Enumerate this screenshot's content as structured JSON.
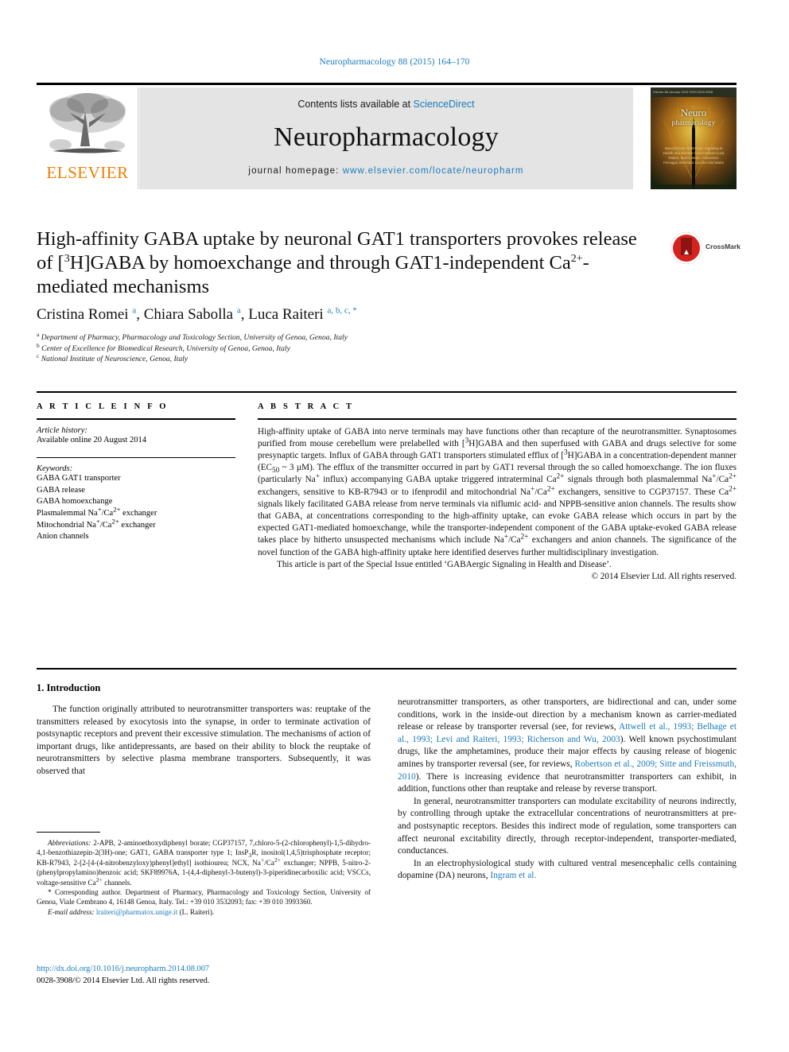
{
  "running_head": "Neuropharmacology 88 (2015) 164–170",
  "masthead": {
    "contents_prefix": "Contents lists available at ",
    "sciencedirect": "ScienceDirect",
    "journal_name": "Neuropharmacology",
    "homepage_prefix": "journal homepage: ",
    "homepage_url": "www.elsevier.com/locate/neuropharm",
    "publisher_logo_text": "ELSEVIER",
    "cover": {
      "title_main": "Neuro",
      "title_sub": "pharmacology",
      "topbar_left": "Volume 88  January 2015  ISSN 0028-3908",
      "topbar_right": "www.elsevier.com",
      "blurb": "Special Issue\nGABAergic Signaling in Health and Disease\n\nGuest Editors\nLuca Raiteri, Marco Beato,\nFrancesco Ferraguti, Bernhard Luscher\nand Maria"
    },
    "accent_link_color": "#1a7bb9",
    "banner_bg": "#e4e4e4",
    "elsevier_orange": "#f07d00"
  },
  "article": {
    "title_html": "High-affinity GABA uptake by neuronal GAT1 transporters provokes release of [<sup>3</sup>H]GABA by homoexchange and through GAT1-independent Ca<sup>2+</sup>-mediated mechanisms",
    "crossmark_label": "CrossMark",
    "authors_html": "Cristina Romei <sup>a</sup>, Chiara Sabolla <sup>a</sup>, Luca Raiteri <sup>a, b, c, *</sup>",
    "affiliations": [
      {
        "marker": "a",
        "text": "Department of Pharmacy, Pharmacology and Toxicology Section, University of Genoa, Genoa, Italy"
      },
      {
        "marker": "b",
        "text": "Center of Excellence for Biomedical Research, University of Genoa, Genoa, Italy"
      },
      {
        "marker": "c",
        "text": "National Institute of Neuroscience, Genoa, Italy"
      }
    ]
  },
  "article_info": {
    "heading": "A R T I C L E   I N F O",
    "history_label": "Article history:",
    "history_value": "Available online 20 August 2014",
    "keywords_label": "Keywords:",
    "keywords_html": [
      "GABA GAT1 transporter",
      "GABA release",
      "GABA homoexchange",
      "Plasmalemmal Na<sup>+</sup>/Ca<sup>2+</sup> exchanger",
      "Mitochondrial Na<sup>+</sup>/Ca<sup>2+</sup> exchanger",
      "Anion channels"
    ]
  },
  "abstract": {
    "heading": "A B S T R A C T",
    "paragraph_html": "High-affinity uptake of GABA into nerve terminals may have functions other than recapture of the neurotransmitter. Synaptosomes purified from mouse cerebellum were prelabelled with [<sup>3</sup>H]GABA and then superfused with GABA and drugs selective for some presynaptic targets. Influx of GABA through GAT1 transporters stimulated efflux of [<sup>3</sup>H]GABA in a concentration-dependent manner (EC<sub>50</sub> ~ 3 µM). The efflux of the transmitter occurred in part by GAT1 reversal through the so called homoexchange. The ion fluxes (particularly Na<sup>+</sup> influx) accompanying GABA uptake triggered intraterminal Ca<sup>2+</sup> signals through both plasmalemmal Na<sup>+</sup>/Ca<sup>2+</sup> exchangers, sensitive to KB-R7943 or to ifenprodil and mitochondrial Na<sup>+</sup>/Ca<sup>2+</sup> exchangers, sensitive to CGP37157. These Ca<sup>2+</sup> signals likely facilitated GABA release from nerve terminals via niflumic acid- and NPPB-sensitive anion channels. The results show that GABA, at concentrations corresponding to the high-affinity uptake, can evoke GABA release which occurs in part by the expected GAT1-mediated homoexchange, while the transporter-independent component of the GABA uptake-evoked GABA release takes place by hitherto unsuspected mechanisms which include Na<sup>+</sup>/Ca<sup>2+</sup> exchangers and anion channels. The significance of the novel function of the GABA high-affinity uptake here identified deserves further multidisciplinary investigation.",
    "special_issue_html": "This article is part of the Special Issue entitled ‘GABAergic Signaling in Health and Disease’.",
    "copyright_html": "© 2014 Elsevier Ltd. All rights reserved."
  },
  "introduction": {
    "heading": "1. Introduction",
    "left_paragraph_html": "The function originally attributed to neurotransmitter transporters was: reuptake of the transmitters released by exocytosis into the synapse, in order to terminate activation of postsynaptic receptors and prevent their excessive stimulation. The mechanisms of action of important drugs, like antidepressants, are based on their ability to block the reuptake of neurotransmitters by selective plasma membrane transporters. Subsequently, it was observed that",
    "right_paragraphs_html": [
      "neurotransmitter transporters, as other transporters, are bidirectional and can, under some conditions, work in the inside-out direction by a mechanism known as carrier-mediated release or release by transporter reversal (see, for reviews, <span class=\"ref\">Attwell et al., 1993; Belhage et al., 1993; Levi and Raiteri, 1993; Richerson and Wu, 2003</span>). Well known psychostimulant drugs, like the amphetamines, produce their major effects by causing release of biogenic amines by transporter reversal (see, for reviews, <span class=\"ref\">Robertson et al., 2009; Sitte and Freissmuth, 2010</span>). There is increasing evidence that neurotransmitter transporters can exhibit, in addition, functions other than reuptake and release by reverse transport.",
      "In general, neurotransmitter transporters can modulate excitability of neurons indirectly, by controlling through uptake the extracellular concentrations of neurotransmitters at pre- and postsynaptic receptors. Besides this indirect mode of regulation, some transporters can affect neuronal excitability directly, through receptor-independent, transporter-mediated, conductances.",
      "In an electrophysiological study with cultured ventral mesencephalic cells containing dopamine (DA) neurons, <span class=\"ref\">Ingram et al.</span>"
    ]
  },
  "footnotes": {
    "abbreviations_html": "<i>Abbreviations:</i> 2-APB, 2-aminoethoxydiphenyl borate; CGP37157, 7,chloro-5-(2-chlorophenyl)-1,5-dihydro-4,1-benzothiazepin-2(3H)-one; GAT1, GABA transporter type 1; InsP<sub>3</sub>R, inositol(1,4,5)trisphosphate receptor; KB-R7943, 2-[2-[4-(4-nitrobenzyloxy)phenyl]ethyl] isothiourea; NCX, Na<sup>+</sup>/Ca<sup>2+</sup> exchanger; NPPB, 5-nitro-2-(phenylpropylamino)benzoic acid; SKF89976A, 1-(4,4-diphenyl-3-butenyl)-3-piperidinecarboxilic acid; VSCCs, voltage-sensitive Ca<sup>2+</sup> channels.",
    "corresponding_html": "* Corresponding author. Department of Pharmacy, Pharmacology and Toxicology Section, University of Genoa, Viale Cembrano 4, 16148 Genoa, Italy. Tel.: +39 010 3532093; fax: +39 010 3993360.",
    "email_label": "E-mail address:",
    "email_address": "lraiteri@pharmatox.unige.it",
    "email_owner": "(L. Raiteri)."
  },
  "footer": {
    "doi_url": "http://dx.doi.org/10.1016/j.neuropharm.2014.08.007",
    "issn_line_html": "0028-3908/© 2014 Elsevier Ltd. All rights reserved."
  }
}
